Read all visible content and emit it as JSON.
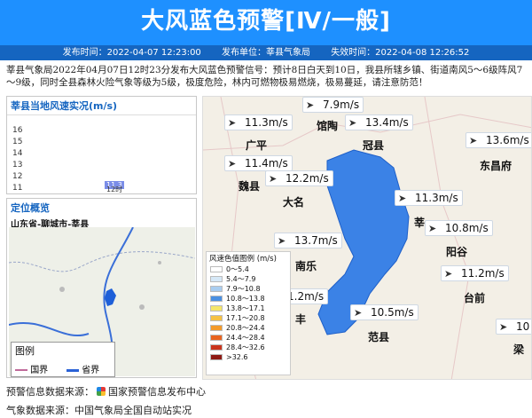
{
  "header": {
    "title": "大风蓝色预警[Ⅳ/一般]",
    "publish_time": "发布时间：2022-04-07 12:23:00",
    "publish_unit": "发布单位：莘县气象局",
    "expire_time": "失效时间：2022-04-08 12:26:52"
  },
  "description": "莘县气象局2022年04月07日12时23分发布大风蓝色预警信号：预计8日白天到10日，我县所辖乡镇、街道南风5～6级阵风7～9级，同时全县森林火险气象等级为5级，极度危险，林内可燃物极易燃烧，极易蔓延，请注意防范！",
  "wind_panel": {
    "title": "莘县当地风速实况(m/s)",
    "yticks": [
      "16",
      "15",
      "14",
      "13",
      "12",
      "11"
    ]
  },
  "chart_data": {
    "type": "bar",
    "title": "莘县当地风速实况(m/s)",
    "categories": [
      "12时"
    ],
    "values": [
      11.3
    ],
    "ylim": [
      11,
      16
    ]
  },
  "location_panel": {
    "title": "定位概览",
    "location": "山东省-聊城市-莘县",
    "legend_title": "图例",
    "legend_items": [
      "国界",
      "省界"
    ]
  },
  "map": {
    "wind_readings": [
      "7.9m/s",
      "11.3m/s",
      "13.4m/s",
      "13.6m/s",
      "11.4m/s",
      "12.2m/s",
      "11.3m/s",
      "10.8m/s",
      "13.7m/s",
      "11.2m/s",
      "1.2m/s",
      "10.5m/s",
      "10"
    ],
    "cities": [
      "馆陶",
      "广平",
      "冠县",
      "东昌府",
      "魏县",
      "大名",
      "莘",
      "阳谷",
      "南乐",
      "台前",
      "丰",
      "范县",
      "梁"
    ]
  },
  "color_legend": {
    "title": "风速色值图例 (m/s)",
    "items": [
      {
        "label": "0～5.4",
        "color": "#ffffff"
      },
      {
        "label": "5.4～7.9",
        "color": "#d6e8f7"
      },
      {
        "label": "7.9～10.8",
        "color": "#a9cdf0"
      },
      {
        "label": "10.8～13.8",
        "color": "#4a90e2"
      },
      {
        "label": "13.8～17.1",
        "color": "#f5e66a"
      },
      {
        "label": "17.1～20.8",
        "color": "#f6c244"
      },
      {
        "label": "20.8～24.4",
        "color": "#f39a2b"
      },
      {
        "label": "24.4～28.4",
        "color": "#e86420"
      },
      {
        "label": "28.4～32.6",
        "color": "#c9341d"
      },
      {
        "label": ">32.6",
        "color": "#8e1a14"
      }
    ]
  },
  "footer": {
    "warning_source_label": "预警信息数据来源：",
    "warning_source": "国家预警信息发布中心",
    "weather_source": "气象数据来源：中国气象局全国自动站实况"
  }
}
